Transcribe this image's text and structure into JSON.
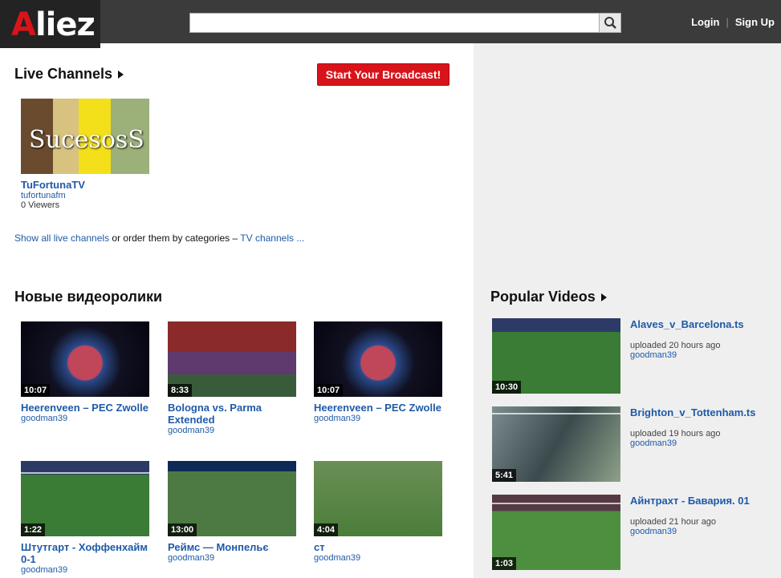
{
  "header": {
    "logo": "liez",
    "logo_first": "A",
    "search_placeholder": "",
    "login": "Login",
    "separator": "|",
    "signup": "Sign Up"
  },
  "live": {
    "heading": "Live Channels",
    "broadcast_button": "Start Your Broadcast!",
    "channel": {
      "title": "TuFortunaTV",
      "user": "tufortunafm",
      "viewers": "0 Viewers",
      "thumb_text": "SucesosS"
    },
    "links": {
      "show_all": "Show all live channels",
      "middle": " or order them by categories – ",
      "tv": "TV channels ..."
    }
  },
  "new_videos": {
    "heading": "Новые видеоролики",
    "items": [
      {
        "title": "Heerenveen – PEC Zwolle",
        "user": "goodman39",
        "duration": "10:07"
      },
      {
        "title": "Bologna vs. Parma Extended",
        "user": "goodman39",
        "duration": "8:33"
      },
      {
        "title": "Heerenveen – PEC Zwolle",
        "user": "goodman39",
        "duration": "10:07"
      },
      {
        "title": "Штутгарт - Хоффенхайм 0-1",
        "user": "goodman39",
        "duration": "1:22"
      },
      {
        "title": "Реймс — Монпельє",
        "user": "goodman39",
        "duration": "13:00"
      },
      {
        "title": "ст",
        "user": "goodman39",
        "duration": "4:04"
      }
    ]
  },
  "popular": {
    "heading": "Popular Videos",
    "items": [
      {
        "title": "Alaves_v_Barcelona.ts",
        "uploaded": "uploaded 20 hours ago",
        "user": "goodman39",
        "duration": "10:30"
      },
      {
        "title": "Brighton_v_Tottenham.ts",
        "uploaded": "uploaded 19 hours ago",
        "user": "goodman39",
        "duration": "5:41"
      },
      {
        "title": "Айнтрахт - Бавария. 01",
        "uploaded": "uploaded 21 hour ago",
        "user": "goodman39",
        "duration": "1:03"
      }
    ]
  },
  "colors": {
    "accent": "#d8141b",
    "link": "#1e5aa8",
    "header": "#3b3b3b"
  }
}
